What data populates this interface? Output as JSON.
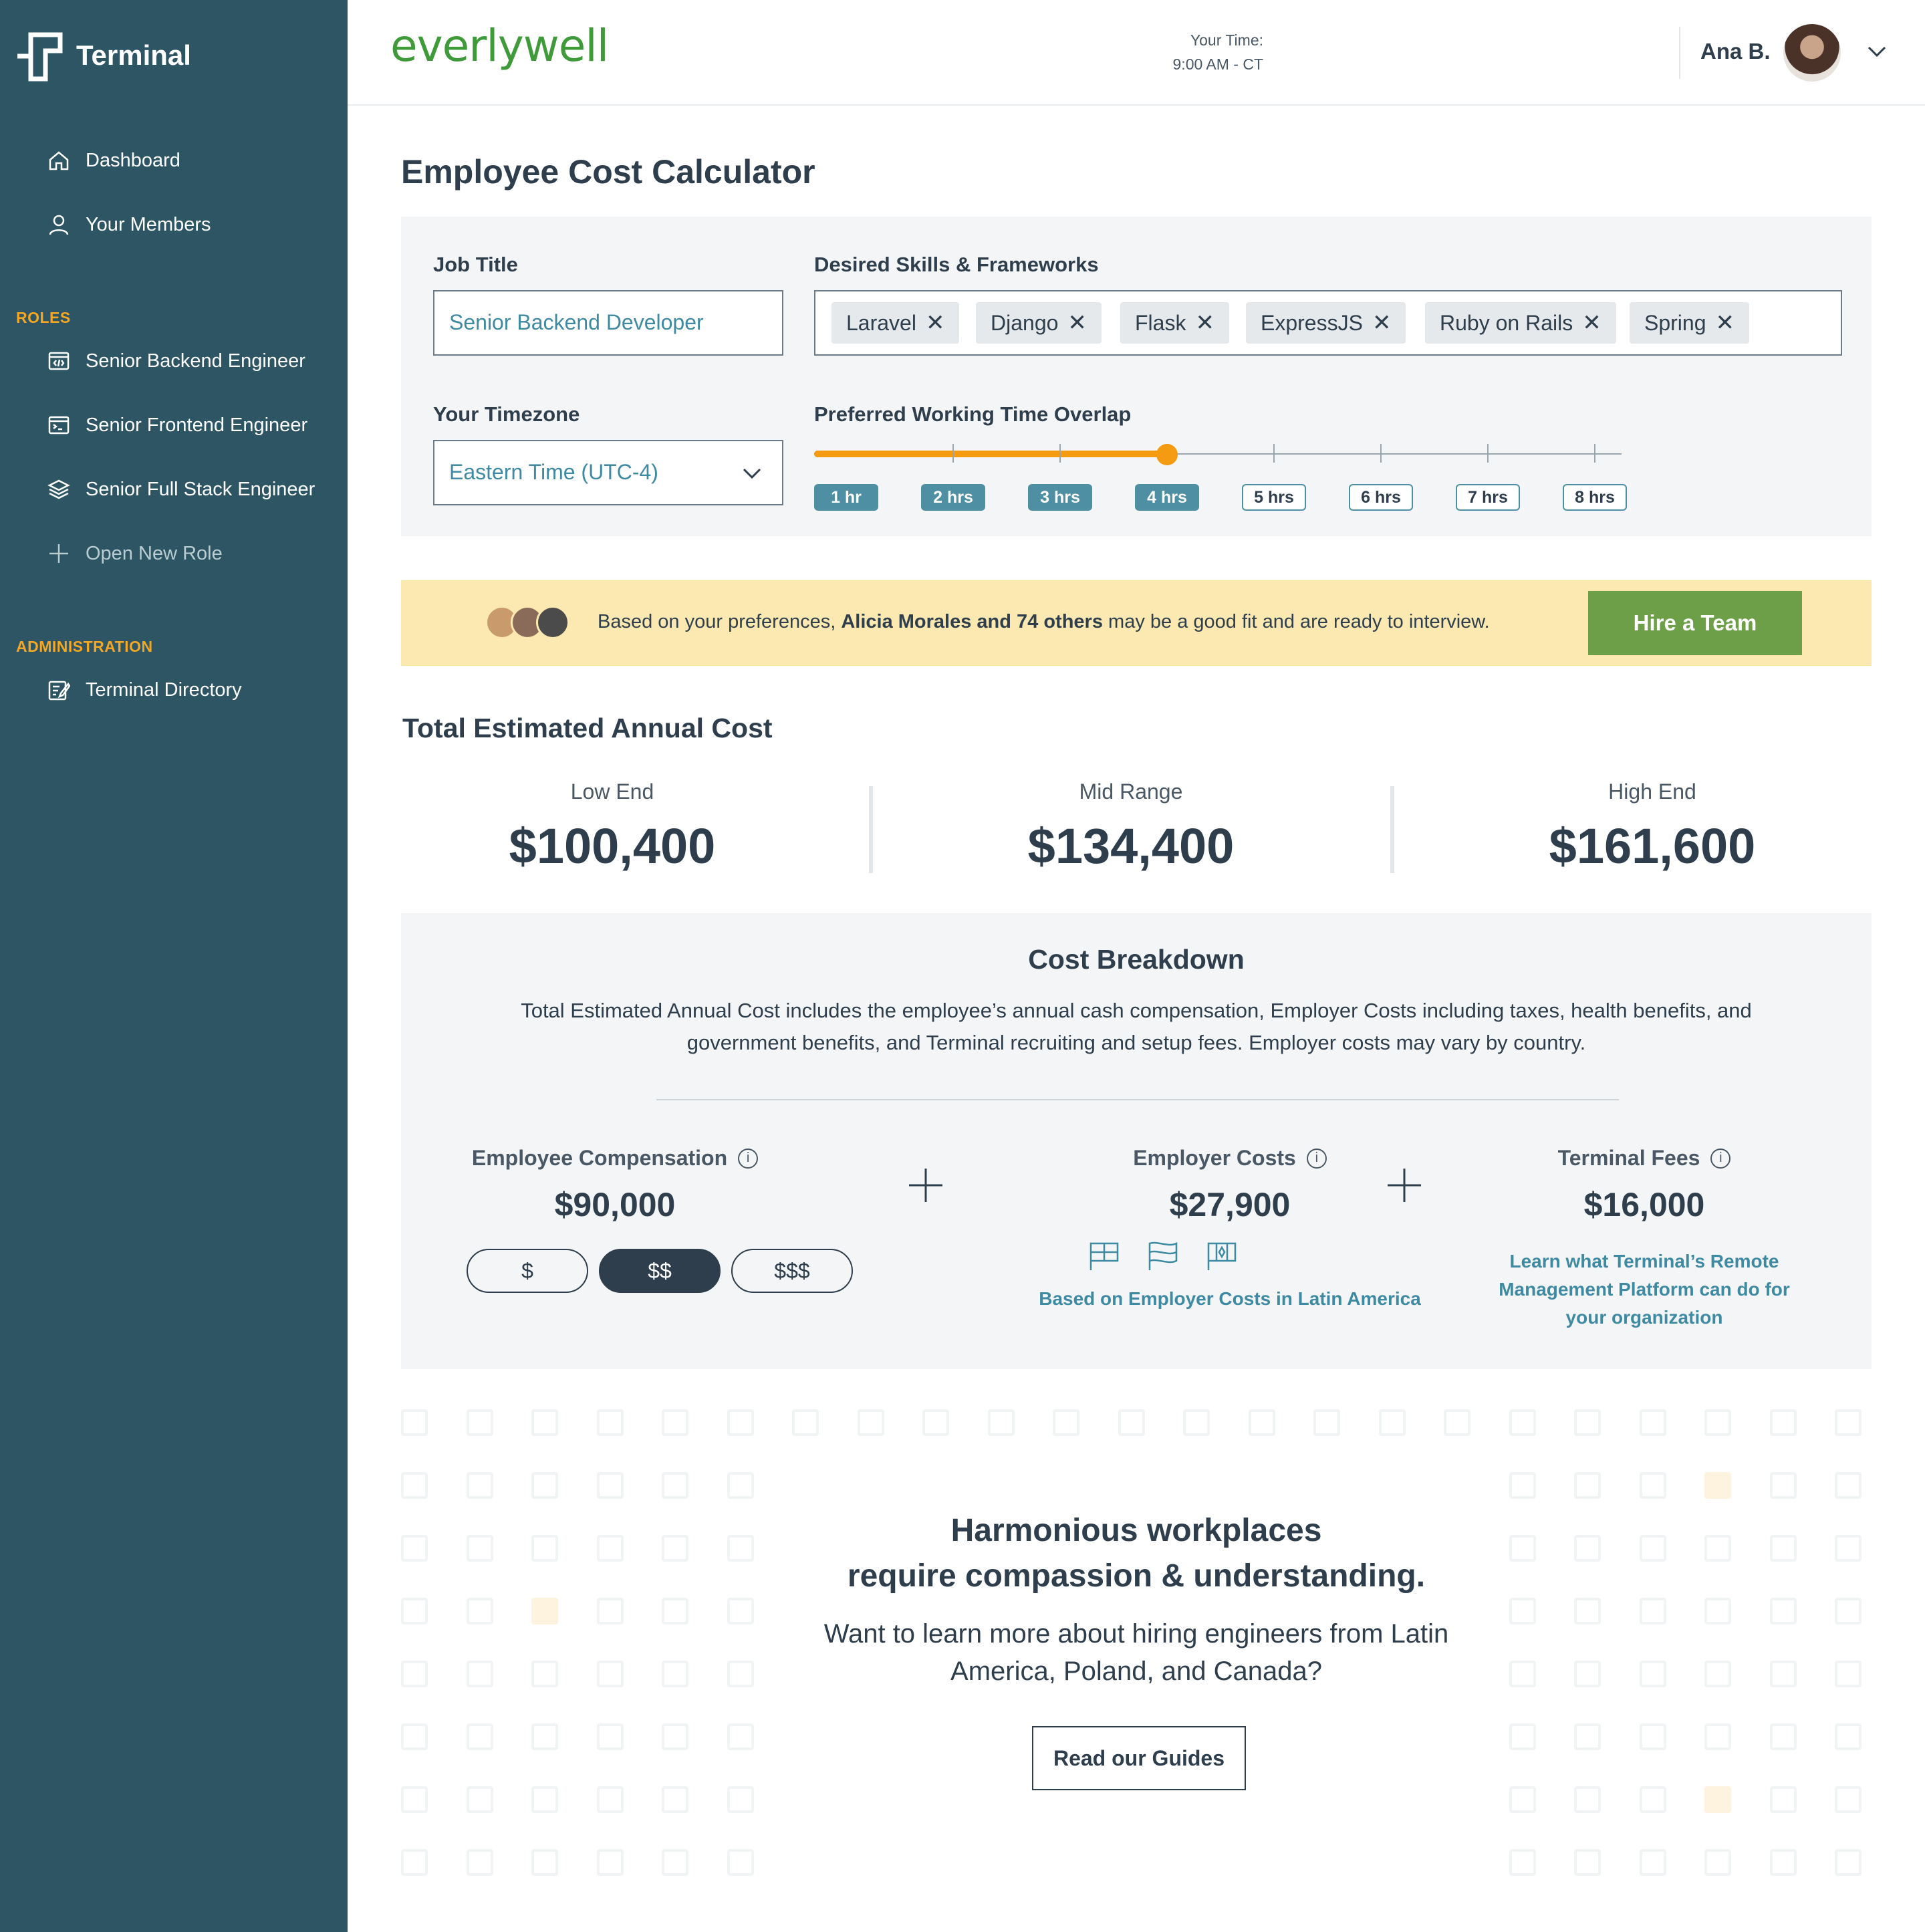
{
  "sidebar": {
    "brand": "Terminal",
    "nav": [
      {
        "label": "Dashboard",
        "icon": "home-icon"
      },
      {
        "label": "Your Members",
        "icon": "user-icon"
      }
    ],
    "roles_label": "ROLES",
    "roles": [
      {
        "label": "Senior Backend Engineer",
        "icon": "code-window-icon"
      },
      {
        "label": "Senior Frontend Engineer",
        "icon": "terminal-window-icon"
      },
      {
        "label": "Senior Full Stack Engineer",
        "icon": "layers-icon"
      }
    ],
    "open_role": "Open New Role",
    "admin_label": "ADMINISTRATION",
    "admin": [
      {
        "label": "Terminal Directory",
        "icon": "edit-list-icon"
      }
    ]
  },
  "header": {
    "logo": "everlywell",
    "your_time_label": "Your Time:",
    "your_time_value": "9:00 AM - CT",
    "user_name": "Ana B."
  },
  "calculator": {
    "title": "Employee Cost Calculator",
    "job_title_label": "Job Title",
    "job_title_value": "Senior Backend Developer",
    "skills_label": "Desired Skills & Frameworks",
    "skills": [
      "Laravel",
      "Django",
      "Flask",
      "ExpressJS",
      "Ruby on Rails",
      "Spring"
    ],
    "timezone_label": "Your Timezone",
    "timezone_value": "Eastern Time (UTC-4)",
    "overlap_label": "Preferred Working Time Overlap",
    "overlap_options": [
      "1 hr",
      "2 hrs",
      "3 hrs",
      "4 hrs",
      "5 hrs",
      "6 hrs",
      "7 hrs",
      "8 hrs"
    ],
    "overlap_selected_hours": 4
  },
  "banner": {
    "prefix": "Based on your preferences, ",
    "highlight": "Alicia Morales and 74 others",
    "suffix": " may be a good fit and are ready to interview.",
    "button": "Hire a Team"
  },
  "totals": {
    "title": "Total Estimated Annual Cost",
    "low_label": "Low End",
    "low_value": "$100,400",
    "mid_label": "Mid Range",
    "mid_value": "$134,400",
    "high_label": "High End",
    "high_value": "$161,600"
  },
  "breakdown": {
    "title": "Cost Breakdown",
    "description": "Total Estimated Annual Cost includes the employee’s annual cash compensation, Employer Costs including taxes, health benefits, and government benefits, and Terminal recruiting and setup fees. Employer costs may vary by country.",
    "comp_label": "Employee Compensation",
    "comp_value": "$90,000",
    "tiers": [
      "$",
      "$$",
      "$$$"
    ],
    "tier_selected": "$$",
    "employer_label": "Employer Costs",
    "employer_value": "$27,900",
    "employer_note": "Based on Employer Costs in Latin America",
    "fees_label": "Terminal Fees",
    "fees_value": "$16,000",
    "fees_note": "Learn what Terminal’s Remote Management Platform can do for your organization"
  },
  "cta": {
    "heading_line1": "Harmonious workplaces",
    "heading_line2": "require compassion & understanding.",
    "body": "Want to learn more about hiring engineers from Latin America, Poland, and Canada?",
    "button": "Read our Guides"
  },
  "colors": {
    "sidebar": "#2d5563",
    "accent_orange": "#f59b12",
    "accent_teal": "#4e8fa3",
    "hire_green": "#6d9f49",
    "banner_yellow": "#fbe9b1",
    "logo_green": "#3f9a3a"
  }
}
